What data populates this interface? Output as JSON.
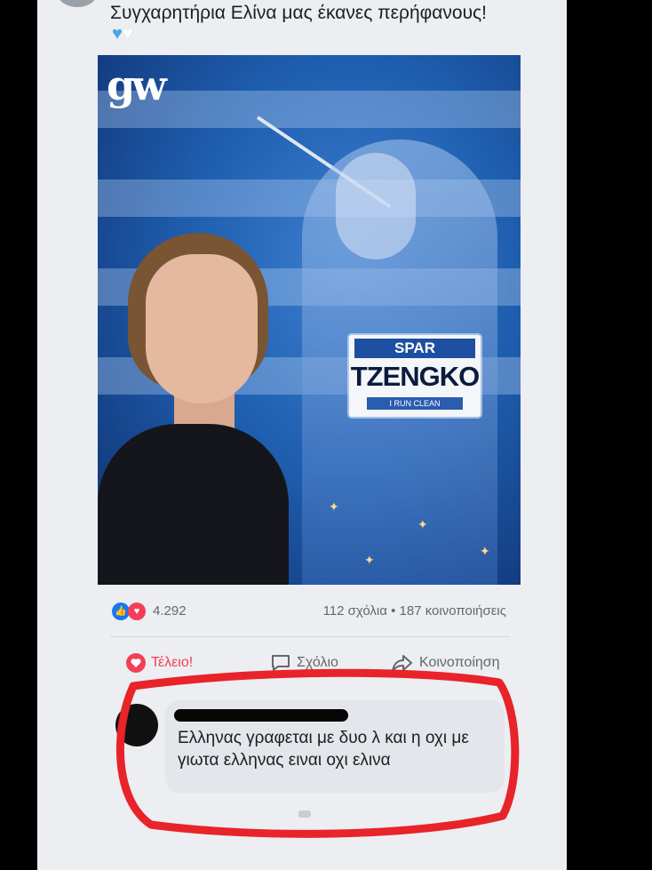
{
  "post": {
    "caption": "Συγχαρητήρια Ελίνα μας έκανες περήφανους!",
    "caption_emoji": [
      "blue-heart",
      "white-heart"
    ],
    "image": {
      "logo_text": "gw",
      "bib_sponsor": "SPAR",
      "bib_name": "TZENGKO",
      "bib_tagline": "I RUN CLEAN"
    }
  },
  "reactions": {
    "count": "4.292",
    "stats": "112 σχόλια • 187 κοινοποιήσεις",
    "icons": [
      "like-icon",
      "love-icon"
    ]
  },
  "actions": {
    "love_label": "Τέλειο!",
    "comment_label": "Σχόλιο",
    "share_label": "Κοινοποίηση"
  },
  "comment": {
    "author": "[redacted]",
    "text": "Ελληνας γραφεται με δυο λ και η οχι με γιωτα ελληνας ειναι οχι ελινα"
  },
  "colors": {
    "accent_love": "#f33e58",
    "accent_like": "#1877f2",
    "highlight_marker": "#e8232a",
    "background": "#000000"
  }
}
